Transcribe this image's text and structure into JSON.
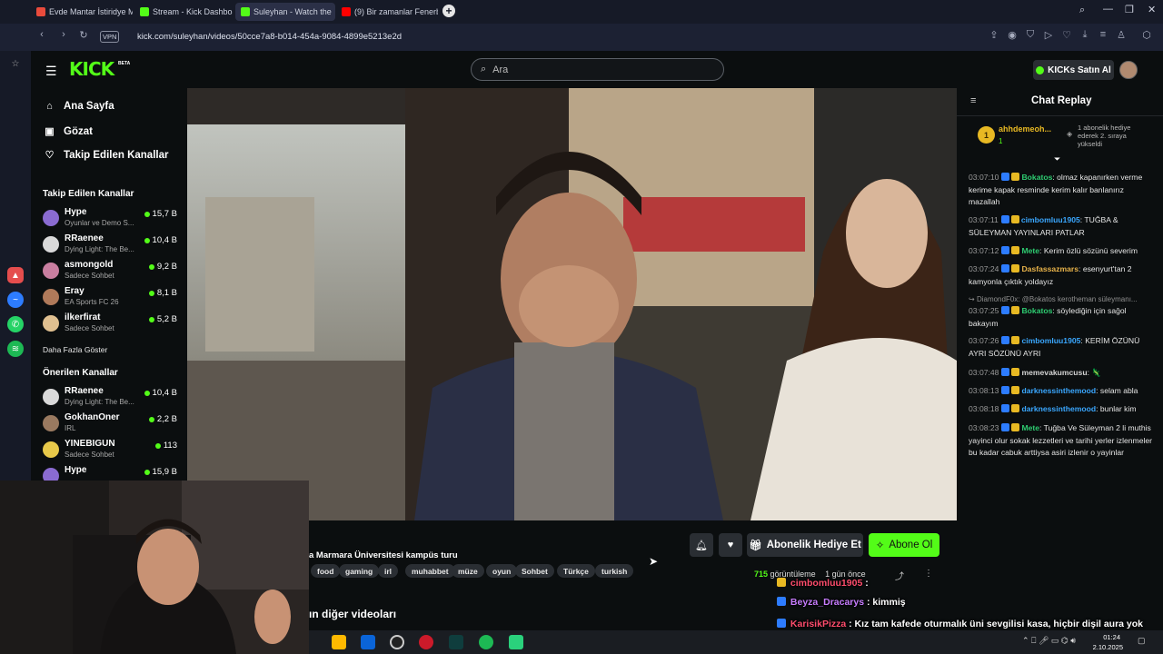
{
  "browser": {
    "tabs": [
      {
        "title": "Evde Mantar İstiridye Mar",
        "favicon_color": "#e94b3c"
      },
      {
        "title": "Stream - Kick Dashboard",
        "favicon_color": "#53fc18"
      },
      {
        "title": "Suleyhan - Watch the",
        "favicon_color": "#53fc18",
        "active": true
      },
      {
        "title": "(9) Bir zamanlar Fenerbahç",
        "favicon_color": "#ff0000"
      }
    ],
    "new_tab": "+",
    "vpn": "VPN",
    "url": "kick.com/suleyhan/videos/50cce7a8-b014-454a-9084-4899e5213e2d"
  },
  "site": {
    "logo": "KICK",
    "logo_badge": "BETA",
    "search_placeholder": "Ara",
    "buy_kicks": "KICKs Satın Al"
  },
  "left_nav": {
    "links": [
      {
        "label": "Ana Sayfa",
        "icon": "home-icon"
      },
      {
        "label": "Gözat",
        "icon": "browse-icon"
      },
      {
        "label": "Takip Edilen Kanallar",
        "icon": "heart-icon"
      }
    ],
    "followed_title": "Takip Edilen Kanallar",
    "followed": [
      {
        "name": "Hype",
        "category": "Oyunlar ve Demo S...",
        "viewers": "15,7 B",
        "color": "#8a6bd1"
      },
      {
        "name": "RRaenee",
        "category": "Dying Light: The Be...",
        "viewers": "10,4 B",
        "color": "#d9d9d9"
      },
      {
        "name": "asmongold",
        "category": "Sadece Sohbet",
        "viewers": "9,2 B",
        "color": "#c97fa0"
      },
      {
        "name": "Eray",
        "category": "EA Sports FC 26",
        "viewers": "8,1 B",
        "color": "#b07a5a"
      },
      {
        "name": "ilkerfirat",
        "category": "Sadece Sohbet",
        "viewers": "5,2 B",
        "color": "#e0c090"
      }
    ],
    "show_more": "Daha Fazla Göster",
    "recommended_title": "Önerilen Kanallar",
    "recommended": [
      {
        "name": "RRaenee",
        "category": "Dying Light: The Be...",
        "viewers": "10,4 B",
        "color": "#d9d9d9"
      },
      {
        "name": "GokhanOner",
        "category": "IRL",
        "viewers": "2,2 B",
        "color": "#9a7a60"
      },
      {
        "name": "YINEBIGUN",
        "category": "Sadece Sohbet",
        "viewers": "113",
        "color": "#e8c94a"
      },
      {
        "name": "Hype",
        "category": "",
        "viewers": "15,9 B",
        "color": "#8a6bd1"
      }
    ]
  },
  "video": {
    "title": "a Marmara Üniversitesi kampüs turu",
    "tags": [
      "food",
      "gaming",
      "irl",
      "muhabbet",
      "müze",
      "oyun",
      "Sohbet",
      "Türkçe",
      "turkish"
    ],
    "views": "715",
    "views_label": "görüntüleme",
    "age": "1 gün önce",
    "gift_sub_label": "Abonelik Hediye Et",
    "subscribe_label": "Abone Ol",
    "other_videos": "ın diğer videoları"
  },
  "chat": {
    "title": "Chat Replay",
    "pinned": {
      "rank": "1",
      "user": "ahhdemeoh...",
      "count": "1",
      "text": "1 abonelik hediye ederek 2. sıraya yükseldi"
    },
    "messages": [
      {
        "time": "03:07:10",
        "user": "Bokatos",
        "color": "#2ecc71",
        "text": "olmaz kapanırken verme kerime kapak resminde kerim kalır banlanırız mazallah"
      },
      {
        "time": "03:07:11",
        "user": "cimbomluu1905",
        "color": "#3aa7ff",
        "text": "TUĞBA & SÜLEYMAN YAYINLARI PATLAR"
      },
      {
        "time": "03:07:12",
        "user": "Mete",
        "color": "#2ecc71",
        "text": "Kerim özlü sözünü severim"
      },
      {
        "time": "03:07:24",
        "user": "Dasfassazmars",
        "color": "#e8b34a",
        "text": "esenyurt'tan 2 kamyonla çıktık yoldayız"
      },
      {
        "reply": "DiamondF0x: @Bokatos kerotheman süleymanı..."
      },
      {
        "time": "03:07:25",
        "user": "Bokatos",
        "color": "#2ecc71",
        "text": "söylediğin için sağol bakayım"
      },
      {
        "time": "03:07:26",
        "user": "cimbomluu1905",
        "color": "#3aa7ff",
        "text": "KERİM ÖZÜNÜ AYRI SÖZÜNÜ AYRI"
      },
      {
        "time": "03:07:48",
        "user": "memevakumcusu",
        "color": "#d4d4d4",
        "text": "🦎"
      },
      {
        "time": "03:08:13",
        "user": "darknessinthemood",
        "color": "#3aa7ff",
        "text": "selam abla"
      },
      {
        "time": "03:08:18",
        "user": "darknessinthemood",
        "color": "#3aa7ff",
        "text": "bunlar kim"
      },
      {
        "time": "03:08:23",
        "user": "Mete",
        "color": "#2ecc71",
        "text": "Tuğba Ve Süleyman 2 li muthis yayinci olur sokak lezzetleri ve tarihi yerler izlenmeler bu kadar cabuk arttiysa asiri izlenir o yayinlar"
      }
    ]
  },
  "stream_overlay": [
    {
      "user": "cimbomluu1905",
      "color": "#ff4d6d",
      "text": ":"
    },
    {
      "user": "Beyza_Dracarys",
      "color": "#c77dff",
      "text": ": kimmiş"
    },
    {
      "user": "KarisikPizza",
      "color": "#ff4d6d",
      "text": ": Kız tam kafede oturmalık üni sevgilisi kasa, hiçbir dişil aura yok"
    }
  ],
  "taskbar": {
    "time": "01:24",
    "date": "2.10.2025"
  }
}
